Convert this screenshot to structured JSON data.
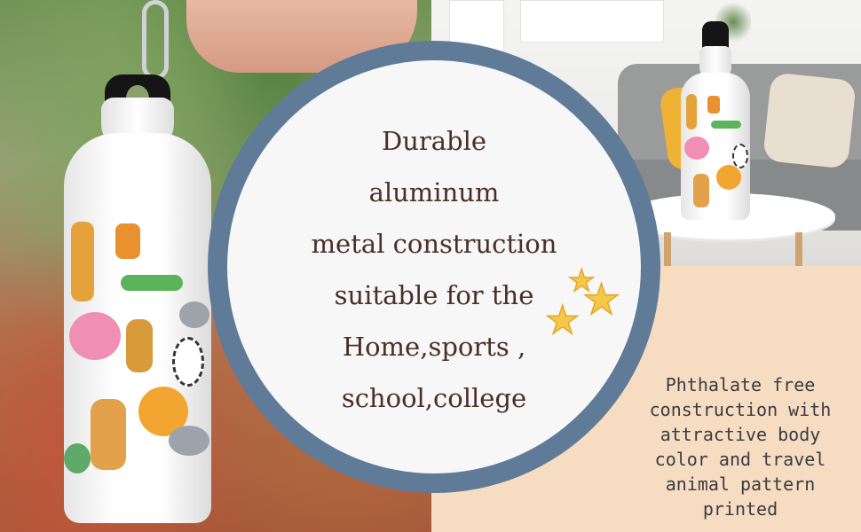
{
  "circle_lines": [
    "Durable",
    "aluminum",
    "metal construction",
    "suitable for the",
    "Home,sports ,",
    "school,college"
  ],
  "side_lines": [
    "Phthalate free",
    "construction with",
    "attractive body",
    "color and travel",
    "animal pattern",
    "printed"
  ],
  "colors": {
    "ring": "#5f7b98",
    "circle_fill": "#f7f7f7",
    "circle_text": "#4a2e29",
    "side_background": "#f6dcc0",
    "side_text": "#3a3d42",
    "star": "#f6c84a"
  },
  "icons": [
    "star-icon",
    "star-icon",
    "star-icon"
  ]
}
